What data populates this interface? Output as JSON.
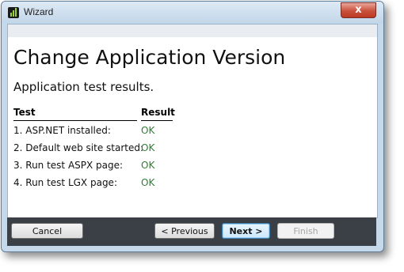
{
  "window": {
    "title": "Wizard",
    "close_glyph": "x"
  },
  "page": {
    "heading": "Change Application Version",
    "subheading": "Application test results."
  },
  "results": {
    "headers": {
      "test": "Test",
      "result": "Result"
    },
    "rows": [
      {
        "test": "1. ASP.NET installed:",
        "result": "OK"
      },
      {
        "test": "2. Default web site started:",
        "result": "OK"
      },
      {
        "test": "3. Run test ASPX page:",
        "result": "OK"
      },
      {
        "test": "4. Run test LGX page:",
        "result": "OK"
      }
    ],
    "ok_color": "#2e7d32"
  },
  "buttons": {
    "cancel": "Cancel",
    "previous": "< Previous",
    "next": "Next >",
    "finish": "Finish"
  },
  "icons": {
    "app_icon": "bar-chart-icon",
    "close_icon": "close-icon"
  }
}
